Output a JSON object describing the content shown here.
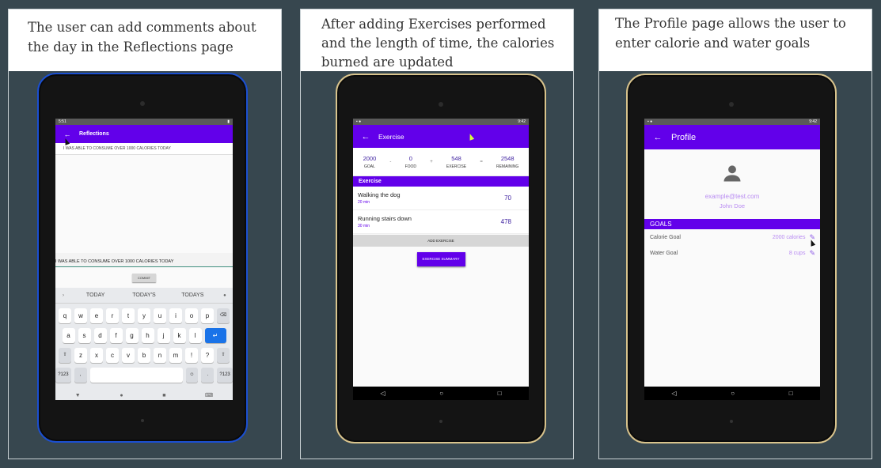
{
  "panels": [
    {
      "caption": "The user can add comments about the day in the Reflections page",
      "screen": {
        "status_time": "5:51",
        "title": "Reflections",
        "entry": "I WAS ABLE TO CONSUME OVER 1000 CALORIES TODAY",
        "input_value": "I WAS ABLE TO CONSUME OVER 1000 CALORIES TODAY",
        "commit_label": "COMMIT",
        "suggestions": [
          "TODAY",
          "TODAY'S",
          "TODAYS"
        ],
        "rows": [
          [
            "q",
            "w",
            "e",
            "r",
            "t",
            "y",
            "u",
            "i",
            "o",
            "p"
          ],
          [
            "a",
            "s",
            "d",
            "f",
            "g",
            "h",
            "j",
            "k",
            "l"
          ],
          [
            "z",
            "x",
            "c",
            "v",
            "b",
            "n",
            "m",
            "!",
            "?"
          ]
        ],
        "sym_label": "?123",
        "comma": ",",
        "period": "."
      }
    },
    {
      "caption": "After adding Exercises performed and the length of time, the calories burned are updated",
      "screen": {
        "status_time": "9:42",
        "title": "Exercise",
        "calories": [
          {
            "value": "2000",
            "label": "GOAL"
          },
          {
            "value": "0",
            "label": "FOOD"
          },
          {
            "value": "548",
            "label": "EXERCISE"
          },
          {
            "value": "2548",
            "label": "REMAINING"
          }
        ],
        "ops": [
          "-",
          "+",
          "="
        ],
        "section": "Exercise",
        "exercises": [
          {
            "name": "Walking the dog",
            "duration": "20 min",
            "calories": "70"
          },
          {
            "name": "Running stairs down",
            "duration": "30 min",
            "calories": "478"
          }
        ],
        "add_label": "ADD EXERCISE",
        "summary_label": "EXERCISE SUMMARY"
      }
    },
    {
      "caption": "The Profile page allows the user to enter calorie and water goals",
      "screen": {
        "status_time": "9:42",
        "title": "Profile",
        "email": "example@test.com",
        "name": "John Doe",
        "goals_header": "GOALS",
        "goals": [
          {
            "label": "Calorie Goal",
            "value": "2000 calories"
          },
          {
            "label": "Water Goal",
            "value": "8 cups"
          }
        ]
      }
    }
  ],
  "icons": {
    "back": "arrow-back-icon",
    "person": "person-icon",
    "edit": "pencil-icon",
    "nav_back": "◁",
    "nav_home": "○",
    "nav_recent": "□",
    "backspace": "⌫",
    "shift": "⇧",
    "enter": "↵",
    "emoji": "☺",
    "mic": "🎤",
    "chevron": "›"
  },
  "colors": {
    "accent": "#6200ea",
    "light_accent": "#b98cf2",
    "background": "#37474f"
  }
}
